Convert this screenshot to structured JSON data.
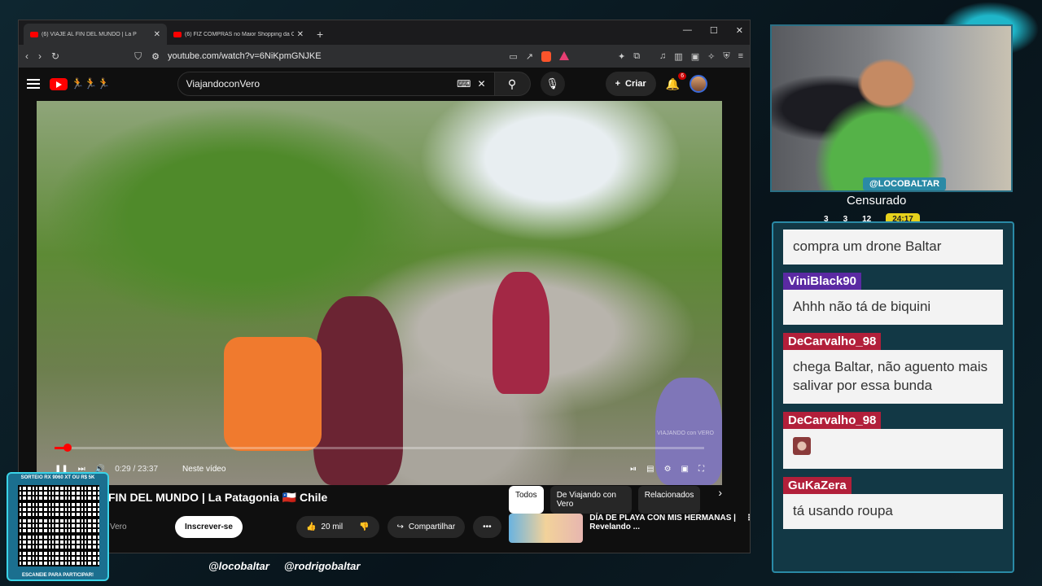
{
  "browser": {
    "tabs": [
      {
        "title": "(6) VIAJÉ AL FIN DEL MUNDO | La P"
      },
      {
        "title": "(6) FIZ COMPRAS no Maior Shopping da Chi"
      }
    ],
    "url": "youtube.com/watch?v=6NiKpmGNJKE"
  },
  "youtube": {
    "search_query": "ViajandoconVero",
    "create_label": "Criar",
    "notif_count": "6",
    "player": {
      "time": "0:29 / 23:37",
      "progress_fraction": 0.02,
      "chapter": "Neste vídeo",
      "watermark": "VIAJANDO con VERO"
    },
    "video_title": "FIN DEL MUNDO | La Patagonia 🇨🇱 Chile",
    "channel": "Vero",
    "subscribe": "Inscrever-se",
    "likes": "20 mil",
    "share": "Compartilhar",
    "chips": [
      "Todos",
      "De Viajando con Vero",
      "Relacionados"
    ],
    "suggestion": {
      "title": "DÍA DE PLAYA CON MIS HERMANAS | Revelando ..."
    }
  },
  "overlay": {
    "qr_top": "SORTEIO RX 9060 XT OU R$ 5K",
    "qr_bottom": "ESCANEIE PARA PARTICIPAR!",
    "socials": [
      "@locobaltar",
      "@rodrigobaltar"
    ],
    "cam_tag": "@LOCOBALTAR",
    "cam_status": "Censurado",
    "stats": [
      "3",
      "3",
      "12"
    ],
    "timer": "24:17"
  },
  "chat": [
    {
      "user": "",
      "text": "compra um drone Baltar",
      "color": "#b21f3a"
    },
    {
      "user": "ViniBlack90",
      "text": "Ahhh não tá de biquini",
      "color": "#5b2aa3"
    },
    {
      "user": "DeCarvalho_98",
      "text": "chega Baltar, não aguento mais salivar por essa bunda",
      "color": "#b21f3a"
    },
    {
      "user": "DeCarvalho_98",
      "text": "",
      "color": "#b21f3a"
    },
    {
      "user": "GuKaZera",
      "text": "tá usando roupa",
      "color": "#b21f3a"
    }
  ]
}
